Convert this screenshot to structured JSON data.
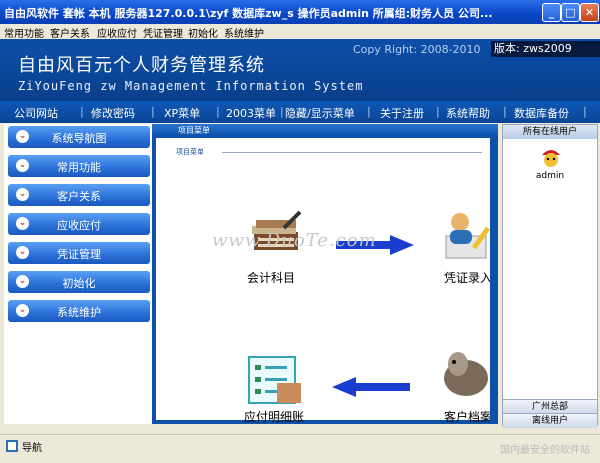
{
  "window": {
    "title": "自由风软件   套帐 本机   服务器127.0.0.1\\zyf  数据库zw_s   操作员admin   所属组:财务人员   公司...",
    "minimize": "_",
    "maximize": "□",
    "close": "✕"
  },
  "menu": [
    "常用功能",
    "客户关系",
    "应收应付",
    "凭证管理",
    "初始化",
    "系统维护"
  ],
  "banner": {
    "title": "自由风百元个人财务管理系统",
    "subtitle": "ZiYouFeng zw Management Information System",
    "copyright": "Copy Right: 2008-2010",
    "version": "版本: zws2009"
  },
  "nav": [
    "公司网站",
    "修改密码",
    "XP菜单",
    "2003菜单",
    "隐藏/显示菜单",
    "关于注册",
    "系统帮助",
    "数据库备份"
  ],
  "left_nav": [
    "系统导航图",
    "常用功能",
    "客户关系",
    "应收应付",
    "凭证管理",
    "初始化",
    "系统维护"
  ],
  "center": {
    "tab": "项目菜单",
    "inner_title": "项目菜单",
    "items": {
      "accounts": "会计科目",
      "voucher": "凭证录入",
      "payable": "应付明细账",
      "customer": "客户档案"
    }
  },
  "right": {
    "header": "所有在线用户",
    "user": "admin",
    "bottom1": "广州总部",
    "bottom2": "离线用户"
  },
  "status": {
    "nav_label": "导航",
    "watermark": "国内最安全的软件站"
  },
  "watermark_text": "www.DuoTe.com",
  "colors": {
    "titlebar": "#0a48c9",
    "banner": "#0c4fa8",
    "button": "#2a6fd7",
    "arrow": "#1a3fd0"
  }
}
